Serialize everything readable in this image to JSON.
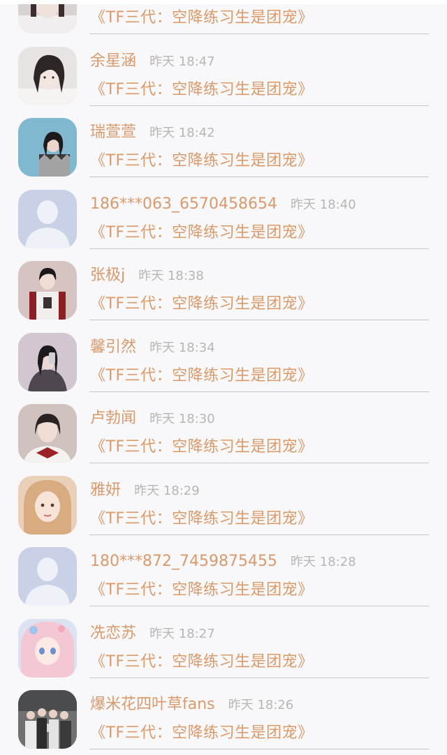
{
  "colors": {
    "background": "#f8f7f9",
    "name": "#d99a6c",
    "time": "#b9b5b5",
    "book": "#dc9a68",
    "divider": "#c9c5c7",
    "default_avatar_bg": "#c9d1e6",
    "default_avatar_fg": "#eef1f8"
  },
  "rows": [
    {
      "name": "",
      "time": "",
      "book": "《TF三代：空降练习生是团宠》",
      "avatar": "photo-portrait-icon",
      "avatar_tone": "#d8d2d0"
    },
    {
      "name": "余星涵",
      "time": "昨天 18:47",
      "book": "《TF三代：空降练习生是团宠》",
      "avatar": "photo-portrait-icon",
      "avatar_tone": "#e9e4e4"
    },
    {
      "name": "瑞萱萱",
      "time": "昨天 18:42",
      "book": "《TF三代：空降练习生是团宠》",
      "avatar": "photo-portrait-icon",
      "avatar_tone": "#7fb8cf"
    },
    {
      "name": "186***063_6570458654",
      "time": "昨天 18:40",
      "book": "《TF三代：空降练习生是团宠》",
      "avatar": "default-user-icon",
      "avatar_tone": "#c9d1e6"
    },
    {
      "name": "张极j",
      "time": "昨天 18:38",
      "book": "《TF三代：空降练习生是团宠》",
      "avatar": "photo-portrait-icon",
      "avatar_tone": "#d6c4c3"
    },
    {
      "name": "馨引然",
      "time": "昨天 18:34",
      "book": "《TF三代：空降练习生是团宠》",
      "avatar": "photo-portrait-icon",
      "avatar_tone": "#d2c6d0"
    },
    {
      "name": "卢勃闻",
      "time": "昨天 18:30",
      "book": "《TF三代：空降练习生是团宠》",
      "avatar": "photo-portrait-icon",
      "avatar_tone": "#cfc2bf"
    },
    {
      "name": "雅妍",
      "time": "昨天 18:29",
      "book": "《TF三代：空降练习生是团宠》",
      "avatar": "photo-portrait-icon",
      "avatar_tone": "#ead0b8"
    },
    {
      "name": "180***872_7459875455",
      "time": "昨天 18:28",
      "book": "《TF三代：空降练习生是团宠》",
      "avatar": "default-user-icon",
      "avatar_tone": "#c9d1e6"
    },
    {
      "name": "冼恋苏",
      "time": "昨天 18:27",
      "book": "《TF三代：空降练习生是团宠》",
      "avatar": "anime-portrait-icon",
      "avatar_tone": "#dbe3f2"
    },
    {
      "name": "爆米花四叶草fans",
      "time": "昨天 18:26",
      "book": "《TF三代：空降练习生是团宠》",
      "avatar": "group-photo-icon",
      "avatar_tone": "#6e7170"
    }
  ]
}
